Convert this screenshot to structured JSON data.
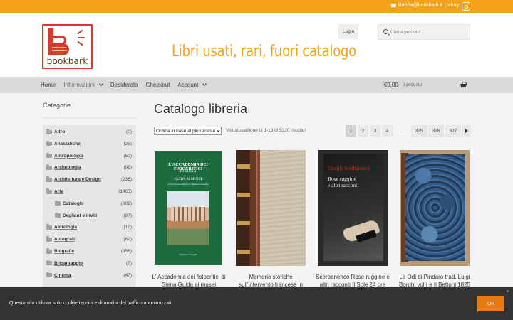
{
  "topbar": {
    "email": "libreria@bookbark.it",
    "separator": "|",
    "ebay": "ebay",
    "instagram_icon": "instagram-icon",
    "mail_icon": "mail-icon"
  },
  "header": {
    "logo_text": "bookbark",
    "tagline": "Libri usati, rari, fuori catalogo",
    "login_label": "Login",
    "search_placeholder": "Cerca prodotti…"
  },
  "nav": {
    "items": [
      {
        "label": "Home",
        "dropdown": false
      },
      {
        "label": "Informazioni",
        "dropdown": true
      },
      {
        "label": "Desiderata",
        "dropdown": false
      },
      {
        "label": "Checkout",
        "dropdown": false
      },
      {
        "label": "Account",
        "dropdown": true
      }
    ],
    "cart_total": "€0,00",
    "cart_count": "0 prodotti"
  },
  "sidebar": {
    "title": "Categorie",
    "categories": [
      {
        "name": "Altro",
        "count": "(0)",
        "sub": false
      },
      {
        "name": "Anastatiche",
        "count": "(25)",
        "sub": false
      },
      {
        "name": "Antropologia",
        "count": "(50)",
        "sub": false
      },
      {
        "name": "Archeologia",
        "count": "(98)",
        "sub": false
      },
      {
        "name": "Architettura e Design",
        "count": "(238)",
        "sub": false
      },
      {
        "name": "Arte",
        "count": "(1463)",
        "sub": false
      },
      {
        "name": "Cataloghi",
        "count": "(609)",
        "sub": true
      },
      {
        "name": "Depliant e inviti",
        "count": "(87)",
        "sub": true
      },
      {
        "name": "Astrologia",
        "count": "(12)",
        "sub": false
      },
      {
        "name": "Autografi",
        "count": "(62)",
        "sub": false
      },
      {
        "name": "Biografie",
        "count": "(356)",
        "sub": false
      },
      {
        "name": "Brigantaggio",
        "count": "(7)",
        "sub": false
      },
      {
        "name": "Cinema",
        "count": "(47)",
        "sub": false
      }
    ]
  },
  "main": {
    "title": "Catalogo libreria",
    "sort_selected": "Ordina in base al più recente",
    "results_text": "Visualizzazione di 1-16 di 5220 risultati",
    "pagination": [
      "1",
      "2",
      "3",
      "4",
      "…",
      "325",
      "326",
      "327"
    ],
    "current_page": "1",
    "products": [
      {
        "title": "L' Accademia dei fisiocritici di Siena Guida ai musei",
        "cover": {
          "line1": "L'ACCADEMIA DEI FISIOCRITICI",
          "line2": "DI SIENA",
          "line3": "GUIDA AI MUSEI",
          "line4": "a cura di Luca Roberto e Barbara Forestieri",
          "footer": "Edizioni Cantagalli"
        }
      },
      {
        "title": "Memorie storiche sull'intervento francese in"
      },
      {
        "title": "Scerbanenco Rose ruggine e altri racconti Il Sole 24 ore",
        "cover": {
          "line1": "Giorgio Scerbanenco",
          "line2": "Rose ruggine",
          "line3": "e altri racconti"
        }
      },
      {
        "title": "Le Odi di Pindaro trad. Luigi Borghi vol.I e Il Bettoni 1825"
      }
    ]
  },
  "cookie": {
    "message": "Questo sito utilizza solo cookie tecnici e di analisi del traffico anonimizzati",
    "ok_label": "OK",
    "close_label": "×"
  },
  "colors": {
    "topbar": "#f3a21a",
    "tagline": "#f3a21a",
    "logo_red": "#d43b2c",
    "nav_bg": "#d9d9d9",
    "cookie_bg": "#333333",
    "ok_button": "#e87a14"
  }
}
